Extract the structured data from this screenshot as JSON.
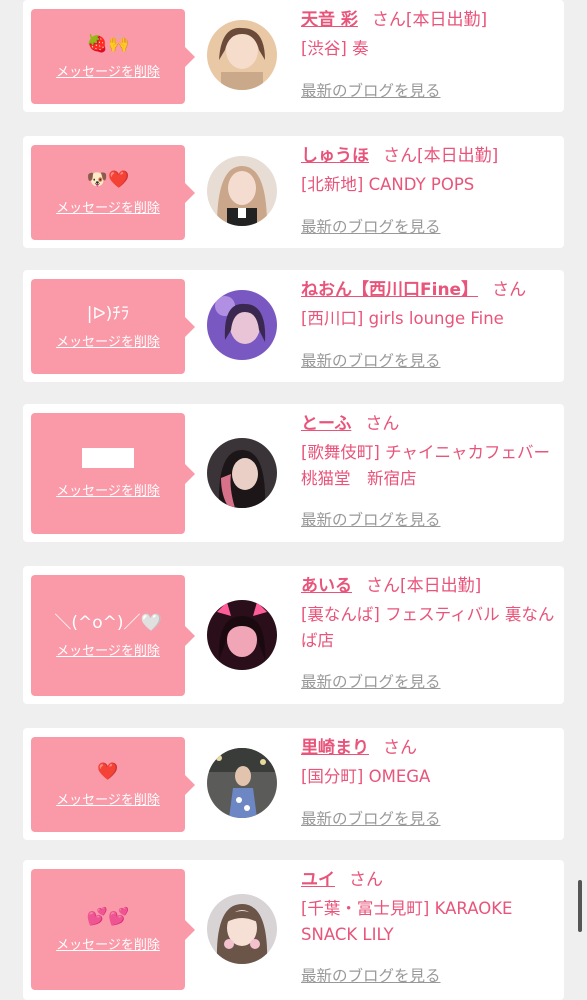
{
  "common": {
    "delete_label": "メッセージを削除",
    "san_label": "さん",
    "blog_label": "最新のブログを見る"
  },
  "entries": [
    {
      "message": "🍓🙌",
      "name": "天音 彩",
      "status": "[本日出勤]",
      "shop": "[渋谷] 奏"
    },
    {
      "message": "🐶❤️",
      "name": "しゅうほ",
      "status": "[本日出勤]",
      "shop": "[北新地] CANDY POPS"
    },
    {
      "message": "|ᐅ)ﾁﾗ",
      "name": "ねおん【西川口Fine】",
      "status": "",
      "shop": "[西川口] girls lounge Fine"
    },
    {
      "message": "",
      "name": "とーふ",
      "status": "",
      "shop": "[歌舞伎町] チャイニャカフェバー 桃猫堂　新宿店"
    },
    {
      "message": "＼(^o^)／🤍",
      "name": "あいる",
      "status": "[本日出勤]",
      "shop": "[裏なんば] フェスティバル 裏なんば店"
    },
    {
      "message": "❤️",
      "name": "里崎まり",
      "status": "",
      "shop": "[国分町] OMEGA"
    },
    {
      "message": "💕💕",
      "name": "ユイ",
      "status": "",
      "shop": "[千葉・富士見町] KARAOKE SNACK LILY"
    }
  ],
  "colors": {
    "accent": "#e8547a",
    "bubble": "#fa9aa9",
    "background": "#efefef",
    "link_gray": "#999999"
  }
}
